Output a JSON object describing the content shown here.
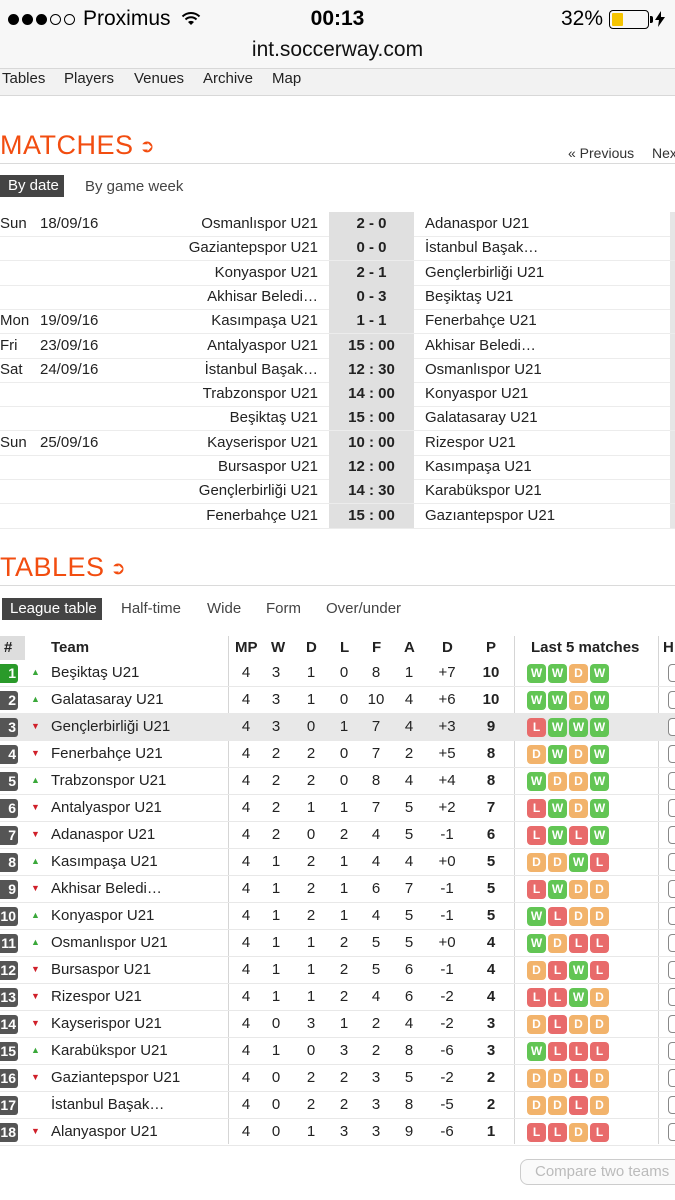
{
  "status": {
    "carrier": "Proximus",
    "signal_icon": "signal-dots-icon",
    "wifi_icon": "wifi-icon",
    "time": "00:13",
    "battery": "32%",
    "battery_level": 0.32,
    "battery_color": "#f5c400",
    "charging_icon": "bolt-icon"
  },
  "url": "int.soccerway.com",
  "nav": [
    "Tables",
    "Players",
    "Venues",
    "Archive",
    "Map"
  ],
  "matches_section": {
    "title": "MATCHES",
    "prev": "« Previous",
    "next": "Next",
    "tabs": [
      "By date",
      "By game week"
    ],
    "rows": [
      {
        "day": "Sun",
        "date": "18/09/16",
        "home": "Osmanlıspor U21",
        "score": "2 - 0",
        "away": "Adanaspor U21"
      },
      {
        "day": "",
        "date": "",
        "home": "Gaziantepspor U21",
        "score": "0 - 0",
        "away": "İstanbul Başak…"
      },
      {
        "day": "",
        "date": "",
        "home": "Konyaspor U21",
        "score": "2 - 1",
        "away": "Gençlerbirliği U21"
      },
      {
        "day": "",
        "date": "",
        "home": "Akhisar Beledi…",
        "score": "0 - 3",
        "away": "Beşiktaş U21"
      },
      {
        "day": "Mon",
        "date": "19/09/16",
        "home": "Kasımpaşa U21",
        "score": "1 - 1",
        "away": "Fenerbahçe U21"
      },
      {
        "day": "Fri",
        "date": "23/09/16",
        "home": "Antalyaspor U21",
        "score": "15 : 00",
        "away": "Akhisar Beledi…"
      },
      {
        "day": "Sat",
        "date": "24/09/16",
        "home": "İstanbul Başak…",
        "score": "12 : 30",
        "away": "Osmanlıspor U21"
      },
      {
        "day": "",
        "date": "",
        "home": "Trabzonspor U21",
        "score": "14 : 00",
        "away": "Konyaspor U21"
      },
      {
        "day": "",
        "date": "",
        "home": "Beşiktaş U21",
        "score": "15 : 00",
        "away": "Galatasaray U21"
      },
      {
        "day": "Sun",
        "date": "25/09/16",
        "home": "Kayserispor U21",
        "score": "10 : 00",
        "away": "Rizespor U21"
      },
      {
        "day": "",
        "date": "",
        "home": "Bursaspor U21",
        "score": "12 : 00",
        "away": "Kasımpaşa U21"
      },
      {
        "day": "",
        "date": "",
        "home": "Gençlerbirliği U21",
        "score": "14 : 30",
        "away": "Karabükspor U21"
      },
      {
        "day": "",
        "date": "",
        "home": "Fenerbahçe U21",
        "score": "15 : 00",
        "away": "Gazıantepspor U21"
      }
    ]
  },
  "tables_section": {
    "title": "TABLES",
    "tabs": [
      "League table",
      "Half-time",
      "Wide",
      "Form",
      "Over/under"
    ],
    "columns": {
      "rank": "#",
      "team": "Team",
      "mp": "MP",
      "w": "W",
      "d": "D",
      "l": "L",
      "f": "F",
      "a": "A",
      "gd": "D",
      "p": "P",
      "form": "Last 5 matches",
      "h": "H"
    },
    "colors": {
      "win": "#62c554",
      "draw": "#f2b36b",
      "loss": "#e86b6b",
      "up": "#3aa83a",
      "down": "#d0202a"
    },
    "rows": [
      {
        "rank": "1",
        "trend": "up",
        "team": "Beşiktaş U21",
        "mp": "4",
        "w": "3",
        "d": "1",
        "l": "0",
        "f": "8",
        "a": "1",
        "gd": "+7",
        "p": "10",
        "form": [
          "W",
          "W",
          "D",
          "W"
        ]
      },
      {
        "rank": "2",
        "trend": "up",
        "team": "Galatasaray U21",
        "mp": "4",
        "w": "3",
        "d": "1",
        "l": "0",
        "f": "10",
        "a": "4",
        "gd": "+6",
        "p": "10",
        "form": [
          "W",
          "W",
          "D",
          "W"
        ]
      },
      {
        "rank": "3",
        "trend": "down",
        "team": "Gençlerbirliği U21",
        "mp": "4",
        "w": "3",
        "d": "0",
        "l": "1",
        "f": "7",
        "a": "4",
        "gd": "+3",
        "p": "9",
        "form": [
          "L",
          "W",
          "W",
          "W"
        ]
      },
      {
        "rank": "4",
        "trend": "down",
        "team": "Fenerbahçe U21",
        "mp": "4",
        "w": "2",
        "d": "2",
        "l": "0",
        "f": "7",
        "a": "2",
        "gd": "+5",
        "p": "8",
        "form": [
          "D",
          "W",
          "D",
          "W"
        ]
      },
      {
        "rank": "5",
        "trend": "up",
        "team": "Trabzonspor U21",
        "mp": "4",
        "w": "2",
        "d": "2",
        "l": "0",
        "f": "8",
        "a": "4",
        "gd": "+4",
        "p": "8",
        "form": [
          "W",
          "D",
          "D",
          "W"
        ]
      },
      {
        "rank": "6",
        "trend": "down",
        "team": "Antalyaspor U21",
        "mp": "4",
        "w": "2",
        "d": "1",
        "l": "1",
        "f": "7",
        "a": "5",
        "gd": "+2",
        "p": "7",
        "form": [
          "L",
          "W",
          "D",
          "W"
        ]
      },
      {
        "rank": "7",
        "trend": "down",
        "team": "Adanaspor U21",
        "mp": "4",
        "w": "2",
        "d": "0",
        "l": "2",
        "f": "4",
        "a": "5",
        "gd": "-1",
        "p": "6",
        "form": [
          "L",
          "W",
          "L",
          "W"
        ]
      },
      {
        "rank": "8",
        "trend": "up",
        "team": "Kasımpaşa U21",
        "mp": "4",
        "w": "1",
        "d": "2",
        "l": "1",
        "f": "4",
        "a": "4",
        "gd": "+0",
        "p": "5",
        "form": [
          "D",
          "D",
          "W",
          "L"
        ]
      },
      {
        "rank": "9",
        "trend": "down",
        "team": "Akhisar Beledi…",
        "mp": "4",
        "w": "1",
        "d": "2",
        "l": "1",
        "f": "6",
        "a": "7",
        "gd": "-1",
        "p": "5",
        "form": [
          "L",
          "W",
          "D",
          "D"
        ]
      },
      {
        "rank": "10",
        "trend": "up",
        "team": "Konyaspor U21",
        "mp": "4",
        "w": "1",
        "d": "2",
        "l": "1",
        "f": "4",
        "a": "5",
        "gd": "-1",
        "p": "5",
        "form": [
          "W",
          "L",
          "D",
          "D"
        ]
      },
      {
        "rank": "11",
        "trend": "up",
        "team": "Osmanlıspor U21",
        "mp": "4",
        "w": "1",
        "d": "1",
        "l": "2",
        "f": "5",
        "a": "5",
        "gd": "+0",
        "p": "4",
        "form": [
          "W",
          "D",
          "L",
          "L"
        ]
      },
      {
        "rank": "12",
        "trend": "down",
        "team": "Bursaspor U21",
        "mp": "4",
        "w": "1",
        "d": "1",
        "l": "2",
        "f": "5",
        "a": "6",
        "gd": "-1",
        "p": "4",
        "form": [
          "D",
          "L",
          "W",
          "L"
        ]
      },
      {
        "rank": "13",
        "trend": "down",
        "team": "Rizespor U21",
        "mp": "4",
        "w": "1",
        "d": "1",
        "l": "2",
        "f": "4",
        "a": "6",
        "gd": "-2",
        "p": "4",
        "form": [
          "L",
          "L",
          "W",
          "D"
        ]
      },
      {
        "rank": "14",
        "trend": "down",
        "team": "Kayserispor U21",
        "mp": "4",
        "w": "0",
        "d": "3",
        "l": "1",
        "f": "2",
        "a": "4",
        "gd": "-2",
        "p": "3",
        "form": [
          "D",
          "L",
          "D",
          "D"
        ]
      },
      {
        "rank": "15",
        "trend": "up",
        "team": "Karabükspor U21",
        "mp": "4",
        "w": "1",
        "d": "0",
        "l": "3",
        "f": "2",
        "a": "8",
        "gd": "-6",
        "p": "3",
        "form": [
          "W",
          "L",
          "L",
          "L"
        ]
      },
      {
        "rank": "16",
        "trend": "down",
        "team": "Gaziantepspor U21",
        "mp": "4",
        "w": "0",
        "d": "2",
        "l": "2",
        "f": "3",
        "a": "5",
        "gd": "-2",
        "p": "2",
        "form": [
          "D",
          "D",
          "L",
          "D"
        ]
      },
      {
        "rank": "17",
        "trend": "none",
        "team": "İstanbul Başak…",
        "mp": "4",
        "w": "0",
        "d": "2",
        "l": "2",
        "f": "3",
        "a": "8",
        "gd": "-5",
        "p": "2",
        "form": [
          "D",
          "D",
          "L",
          "D"
        ]
      },
      {
        "rank": "18",
        "trend": "down",
        "team": "Alanyaspor U21",
        "mp": "4",
        "w": "0",
        "d": "1",
        "l": "3",
        "f": "3",
        "a": "9",
        "gd": "-6",
        "p": "1",
        "form": [
          "L",
          "L",
          "D",
          "L"
        ]
      }
    ],
    "compare_button": "Compare two teams"
  }
}
